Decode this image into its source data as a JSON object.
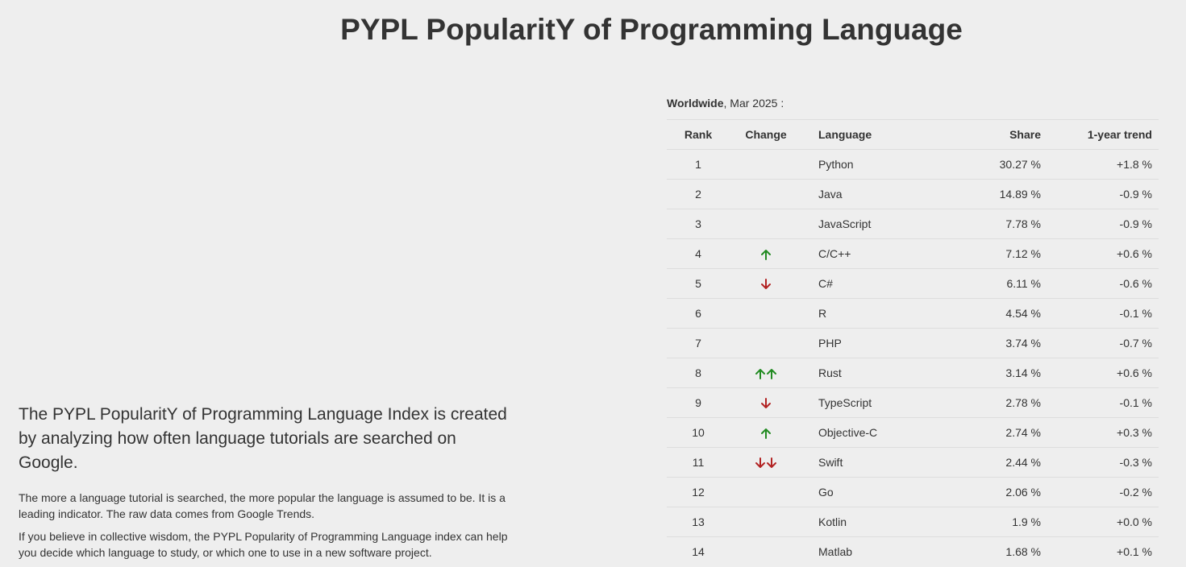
{
  "header": {
    "title": "PYPL PopularitY of Programming Language"
  },
  "intro": {
    "lead": "The PYPL PopularitY of Programming Language Index is created by analyzing how often language tutorials are searched on Google.",
    "paragraphs": [
      "The more a language tutorial is searched, the more popular the language is assumed to be. It is a leading indicator. The raw data comes from Google Trends.",
      "If you believe in collective wisdom, the PYPL Popularity of Programming Language index can help you decide which language to study, or which one to use in a new software project."
    ]
  },
  "table": {
    "caption_region": "Worldwide",
    "caption_rest": ", Mar 2025 :",
    "headers": {
      "rank": "Rank",
      "change": "Change",
      "language": "Language",
      "share": "Share",
      "trend": "1-year trend"
    },
    "rows": [
      {
        "rank": "1",
        "change": "",
        "language": "Python",
        "share": "30.27 %",
        "trend": "+1.8 %"
      },
      {
        "rank": "2",
        "change": "",
        "language": "Java",
        "share": "14.89 %",
        "trend": "-0.9 %"
      },
      {
        "rank": "3",
        "change": "",
        "language": "JavaScript",
        "share": "7.78 %",
        "trend": "-0.9 %"
      },
      {
        "rank": "4",
        "change": "up",
        "language": "C/C++",
        "share": "7.12 %",
        "trend": "+0.6 %"
      },
      {
        "rank": "5",
        "change": "down",
        "language": "C#",
        "share": "6.11 %",
        "trend": "-0.6 %"
      },
      {
        "rank": "6",
        "change": "",
        "language": "R",
        "share": "4.54 %",
        "trend": "-0.1 %"
      },
      {
        "rank": "7",
        "change": "",
        "language": "PHP",
        "share": "3.74 %",
        "trend": "-0.7 %"
      },
      {
        "rank": "8",
        "change": "up-up",
        "language": "Rust",
        "share": "3.14 %",
        "trend": "+0.6 %"
      },
      {
        "rank": "9",
        "change": "down",
        "language": "TypeScript",
        "share": "2.78 %",
        "trend": "-0.1 %"
      },
      {
        "rank": "10",
        "change": "up",
        "language": "Objective-C",
        "share": "2.74 %",
        "trend": "+0.3 %"
      },
      {
        "rank": "11",
        "change": "down-down",
        "language": "Swift",
        "share": "2.44 %",
        "trend": "-0.3 %"
      },
      {
        "rank": "12",
        "change": "",
        "language": "Go",
        "share": "2.06 %",
        "trend": "-0.2 %"
      },
      {
        "rank": "13",
        "change": "",
        "language": "Kotlin",
        "share": "1.9 %",
        "trend": "+0.0 %"
      },
      {
        "rank": "14",
        "change": "",
        "language": "Matlab",
        "share": "1.68 %",
        "trend": "+0.1 %"
      }
    ]
  },
  "colors": {
    "up": "#228b22",
    "down": "#b22222",
    "text": "#333333",
    "background": "#eeeeee"
  },
  "icons": {
    "up": "arrow-up-icon",
    "down": "arrow-down-icon"
  }
}
